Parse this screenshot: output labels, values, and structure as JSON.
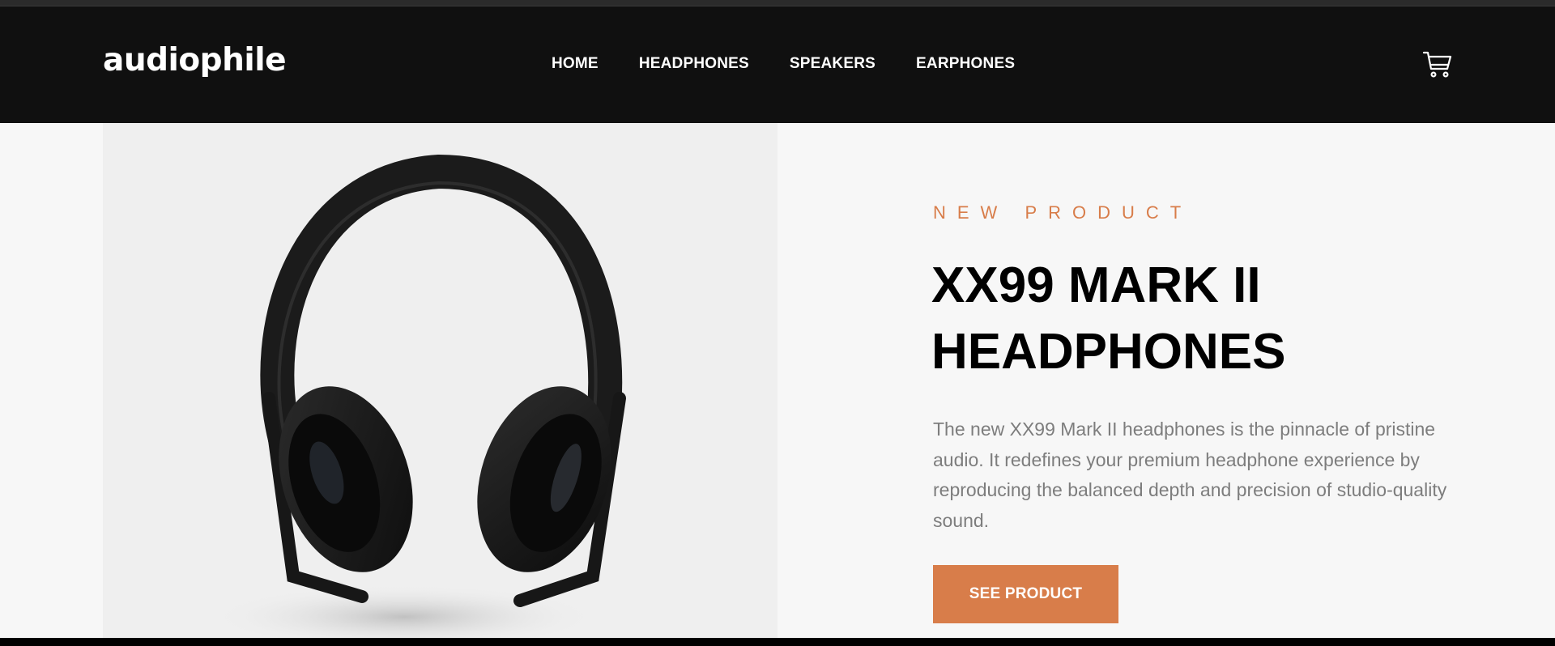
{
  "brand": {
    "logo_text": "audiophile"
  },
  "nav": {
    "items": [
      {
        "label": "HOME"
      },
      {
        "label": "HEADPHONES"
      },
      {
        "label": "SPEAKERS"
      },
      {
        "label": "EARPHONES"
      }
    ]
  },
  "header": {
    "cart_icon": "cart-icon"
  },
  "hero": {
    "overline": "NEW PRODUCT",
    "title_line1": "XX99 MARK II",
    "title_line2": "HEADPHONES",
    "description": "The new XX99 Mark II headphones is the pinnacle of pristine audio. It redefines your premium headphone experience by reproducing the balanced depth and precision of studio-quality sound.",
    "cta_label": "SEE PRODUCT"
  },
  "colors": {
    "accent": "#d87d4a",
    "header_bg": "#101010",
    "hero_bg": "#f7f7f7",
    "text_dark": "#000000",
    "text_muted": "#7d7d7d"
  }
}
